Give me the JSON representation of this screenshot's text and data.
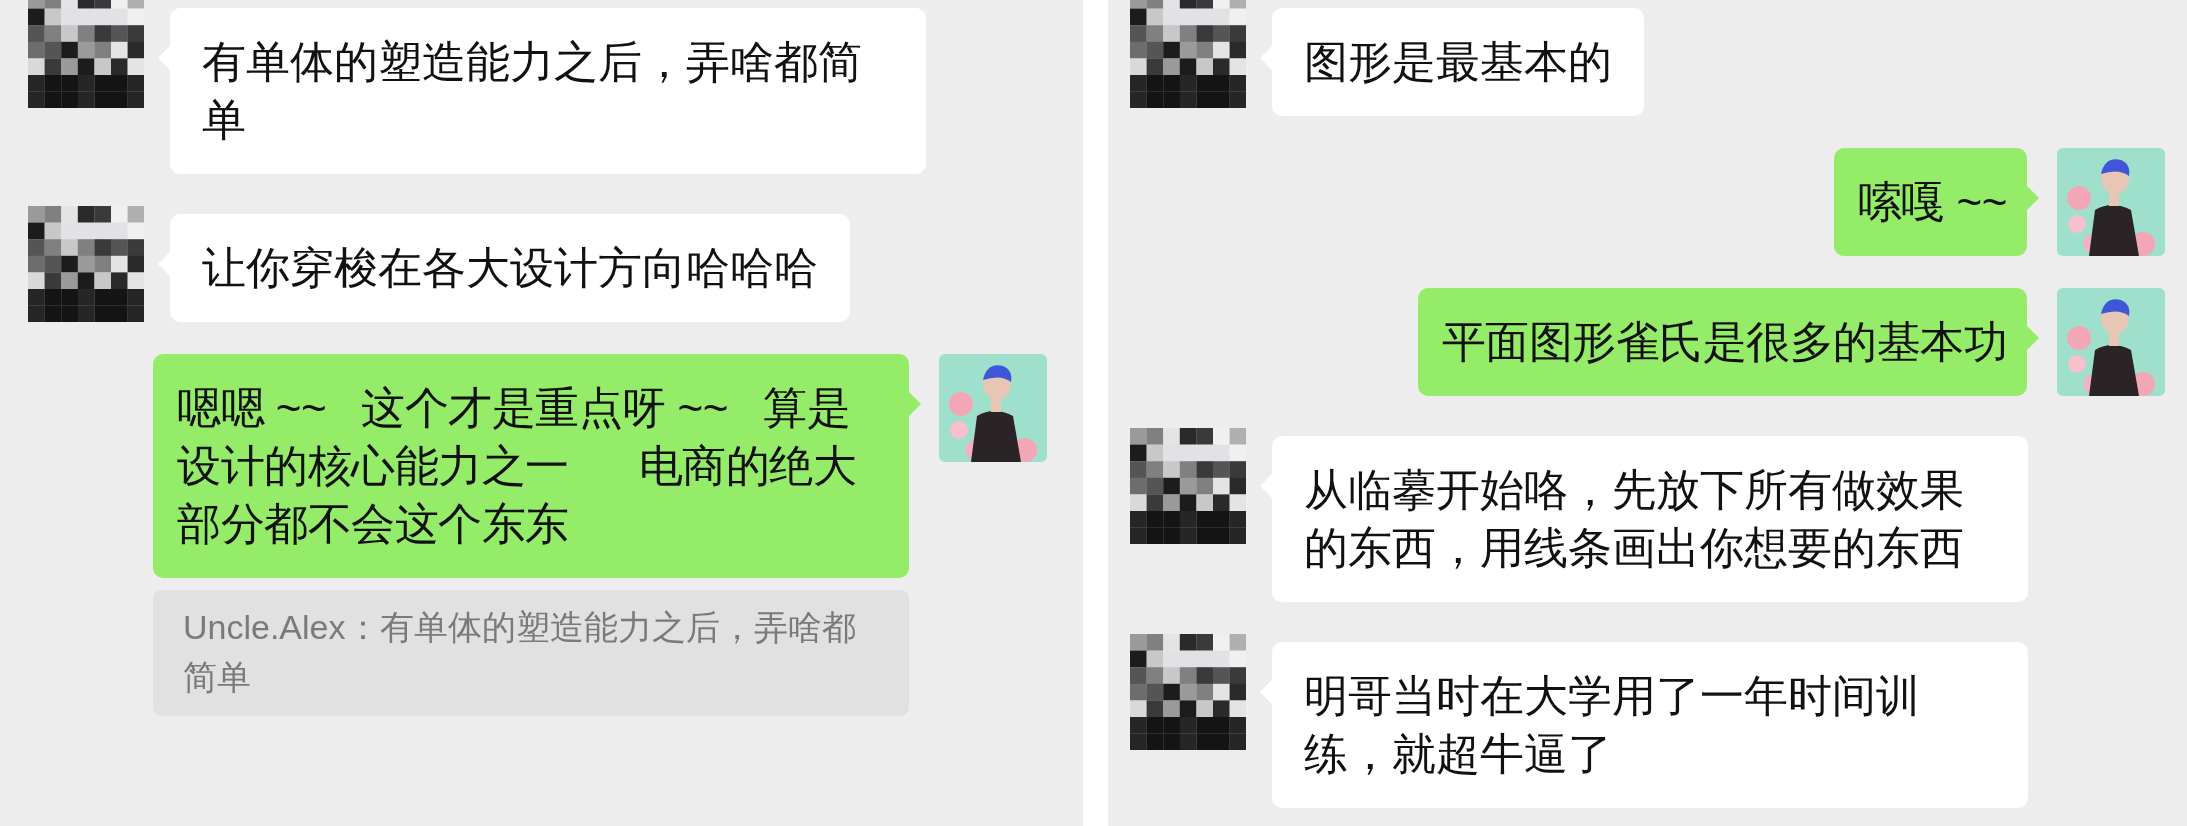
{
  "panels": [
    {
      "messages": [
        {
          "kind": "received",
          "text": "有单体的塑造能力之后，弄啥都简单"
        },
        {
          "kind": "received",
          "text": "让你穿梭在各大设计方向哈哈哈"
        },
        {
          "kind": "sent",
          "text": "嗯嗯 ~~   这个才是重点呀 ~~   算是设计的核心能力之一      电商的绝大部分都不会这个东东",
          "quote": "Uncle.Alex：有单体的塑造能力之后，弄啥都简单"
        }
      ]
    },
    {
      "messages": [
        {
          "kind": "received",
          "text": "图形是最基本的"
        },
        {
          "kind": "sent",
          "text": "嗦嘎 ~~"
        },
        {
          "kind": "sent",
          "text": "平面图形雀氏是很多的基本功"
        },
        {
          "kind": "received",
          "text": "从临摹开始咯，先放下所有做效果的东西，用线条画出你想要的东西"
        },
        {
          "kind": "received",
          "text": "明哥当时在大学用了一年时间训练，就超牛逼了"
        }
      ]
    }
  ]
}
